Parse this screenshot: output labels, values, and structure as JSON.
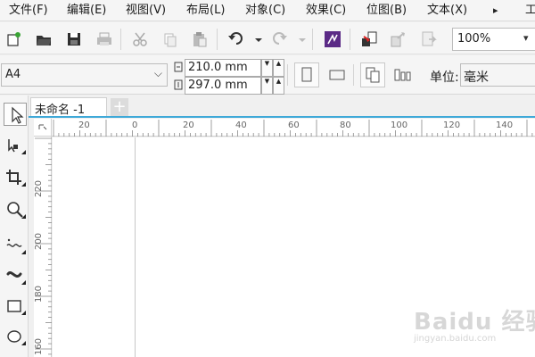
{
  "menu": {
    "items": [
      "文件(F)",
      "编辑(E)",
      "视图(V)",
      "布局(L)",
      "对象(C)",
      "效果(C)",
      "位图(B)",
      "文本(X)"
    ],
    "more_symbol": "▸",
    "cut_off": "工"
  },
  "toolbar": {
    "zoom_value": "100%",
    "zoom_arrow": "▾",
    "icons": [
      "new-document-icon",
      "open-folder-icon",
      "save-icon",
      "print-icon",
      "cut-icon",
      "copy-icon",
      "paste-icon",
      "undo-icon",
      "redo-icon",
      "launch-app-icon",
      "import-icon",
      "export-icon",
      "publish-pdf-icon"
    ]
  },
  "property_bar": {
    "page_size": "A4",
    "page_size_arrow": "⌵",
    "width": "210.0 mm",
    "height": "297.0 mm",
    "spin_up": "▲",
    "spin_down": "▼",
    "unit_label": "单位:",
    "unit_value": "毫米"
  },
  "toolbox": {
    "tools": [
      "pick-tool",
      "shape-tool",
      "crop-tool",
      "zoom-tool",
      "freehand-tool",
      "artistic-media-tool",
      "rectangle-tool",
      "ellipse-tool"
    ]
  },
  "tabs": {
    "document_tab": "未命名 -1",
    "add_symbol": "+"
  },
  "rulers": {
    "horizontal": [
      "20",
      "0",
      "20",
      "40",
      "60",
      "80",
      "100",
      "120",
      "140"
    ],
    "vertical": [
      "220",
      "200",
      "180",
      "160"
    ]
  },
  "watermark": {
    "text": "Baidu 经验",
    "url": "jingyan.baidu.com"
  }
}
